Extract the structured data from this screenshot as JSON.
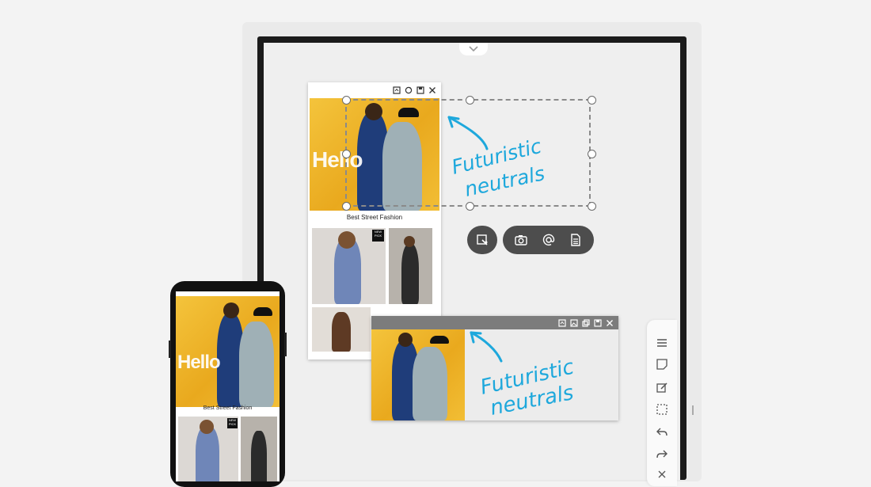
{
  "doc_window": {
    "hello_text": "Hello",
    "caption": "Best Street Fashion",
    "badge": "NEW PICK"
  },
  "handwriting": {
    "line1": "Futuristic",
    "line2": "neutrals"
  },
  "phone": {
    "hello_text": "Hello",
    "caption": "Best Street Fashion",
    "badge": "NEW PICK"
  },
  "icons": {
    "window_controls": [
      "home-icon",
      "refresh-icon",
      "save-icon",
      "close-icon"
    ],
    "selection_actions": [
      "crop-capture-icon"
    ],
    "share_actions": [
      "camera-icon",
      "email-icon",
      "document-icon"
    ],
    "side_toolbar": [
      "menu-icon",
      "sticky-note-icon",
      "edit-document-icon",
      "select-icon",
      "undo-icon",
      "redo-icon",
      "close-icon"
    ]
  },
  "colors": {
    "handwriting": "#1ea8dc",
    "photo_yellow": "#f2bd32",
    "pill": "#4d4d4d"
  }
}
